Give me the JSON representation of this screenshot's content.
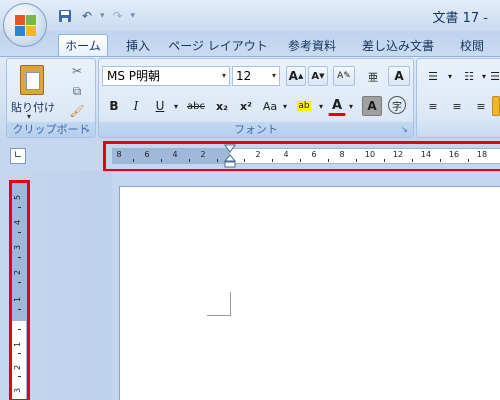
{
  "window": {
    "title": "文書 17 -"
  },
  "tabs": [
    {
      "label": "ホーム",
      "active": true
    },
    {
      "label": "挿入"
    },
    {
      "label": "ページ レイアウト"
    },
    {
      "label": "参考資料"
    },
    {
      "label": "差し込み文書"
    },
    {
      "label": "校閲"
    }
  ],
  "clipboard": {
    "paste_label": "貼り付け",
    "group_label": "クリップボード"
  },
  "font": {
    "name": "MS P明朝",
    "size": "12",
    "group_label": "フォント",
    "bold": "B",
    "italic": "I",
    "underline": "U",
    "strike": "abc",
    "subscript": "x₂",
    "superscript": "x²",
    "change_case": "Aa",
    "grow": "A",
    "shrink": "A",
    "highlight_text": "ab",
    "font_color_text": "A",
    "shading": "A",
    "enclose": "字"
  },
  "ruler": {
    "horizontal_labels": [
      "8",
      "6",
      "4",
      "2",
      "2",
      "4",
      "6",
      "8",
      "10",
      "12",
      "14",
      "16",
      "18"
    ],
    "vertical_labels": [
      "5",
      "4",
      "3",
      "2",
      "1",
      "1",
      "2",
      "3"
    ]
  },
  "colors": {
    "highlight": "#e60012",
    "accent": "#15428b"
  }
}
